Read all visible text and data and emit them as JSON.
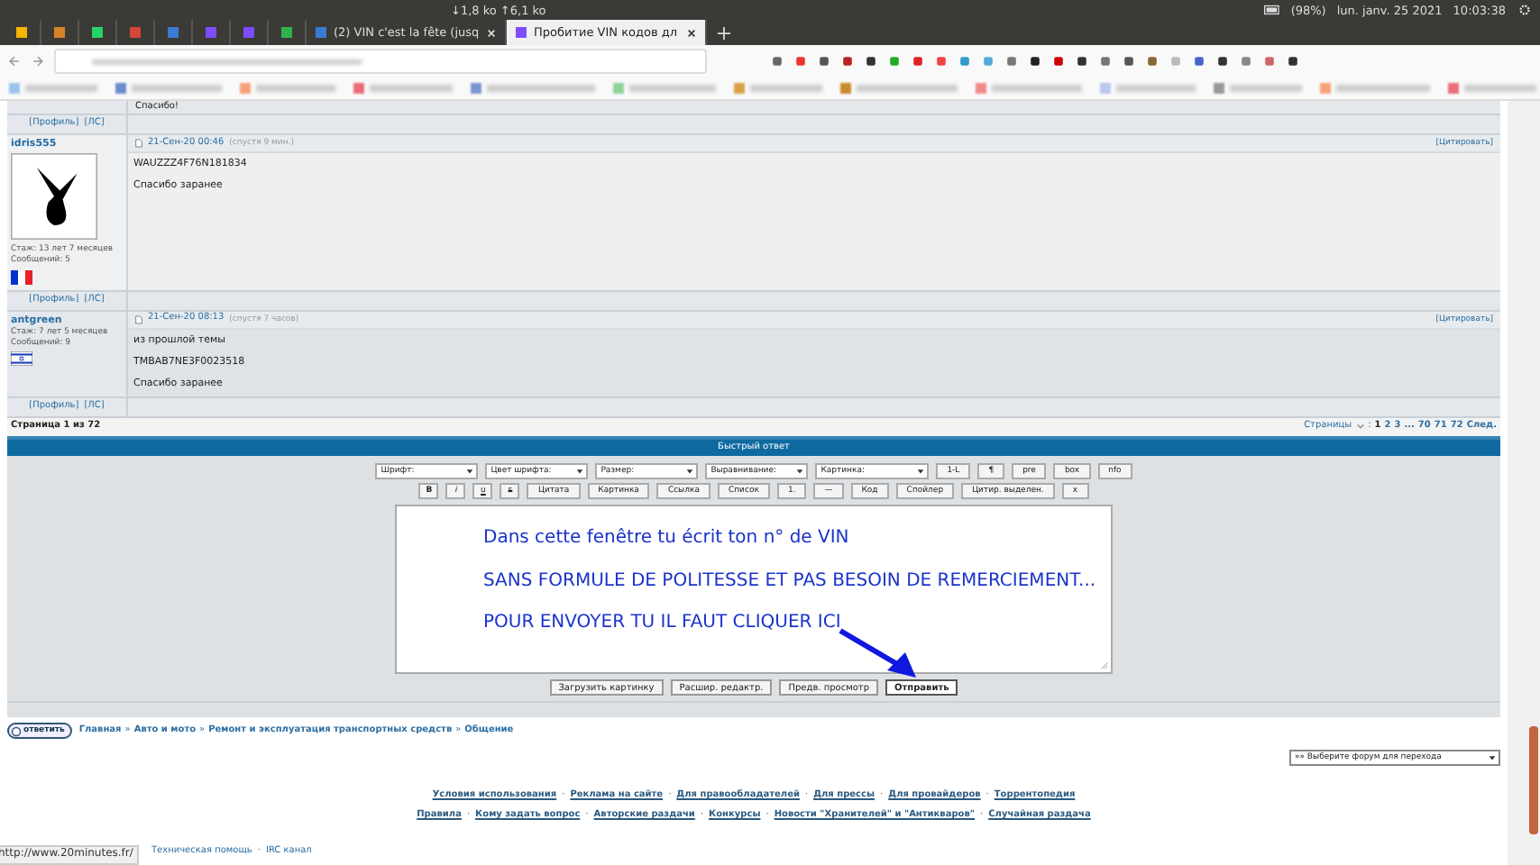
{
  "system_bar": {
    "network": "↓1,8 ko ↑6,1 ko",
    "battery": "(98%)",
    "date": "lun. janv. 25 2021",
    "time": "10:03:38"
  },
  "tabs": [
    {
      "color": "#f5b400",
      "selected": false
    },
    {
      "color": "#d9822b",
      "selected": false
    },
    {
      "color": "#25d366",
      "selected": false
    },
    {
      "color": "#d44638",
      "selected": false
    },
    {
      "color": "#3b7bd4",
      "selected": false
    },
    {
      "color": "#7c4dff",
      "selected": false
    },
    {
      "color": "#7c4dff",
      "selected": false
    },
    {
      "color": "#2eb24b",
      "selected": false
    },
    {
      "title": "(2) VIN c'est la fête (jusq",
      "color": "#3b7bd4",
      "selected": false
    },
    {
      "title": "Пробитие VIN кодов дл",
      "color": "#7c4dff",
      "selected": true
    }
  ],
  "previous_post": {
    "text": "Спасибо!",
    "profile_links": [
      "[Профиль]",
      "[ЛС]"
    ]
  },
  "posts": [
    {
      "author": "idris555",
      "avatar": true,
      "tenure": "Стаж: 13 лет 7 месяцев",
      "messages": "Сообщений: 5",
      "flag": {
        "kind": "tricolor"
      },
      "date": "21-Сен-20 00:46",
      "delay": "(спустя 9 мин.)",
      "quote": "[Цитировать]",
      "lines": [
        "WAUZZZ4F76N181834",
        "Спасибо заранее"
      ],
      "profile_links": [
        "[Профиль]",
        "[ЛС]"
      ]
    },
    {
      "author": "antgreen",
      "avatar": false,
      "tenure": "Стаж: 7 лет 5 месяцев",
      "messages": "Сообщений: 9",
      "flag": {
        "kind": "star"
      },
      "date": "21-Сен-20 08:13",
      "delay": "(спустя 7 часов)",
      "quote": "[Цитировать]",
      "lines": [
        "из прошлой темы",
        "TMBAB7NE3F0023518",
        "Спасибо заранее"
      ],
      "profile_links": [
        "[Профиль]",
        "[ЛС]"
      ]
    }
  ],
  "page_info": "Страница 1 из 72",
  "pagination": {
    "label": "Страницы",
    "colon": ":",
    "pages": [
      {
        "label": "1",
        "selected": true
      },
      {
        "label": "2",
        "selected": false
      },
      {
        "label": "3",
        "selected": false
      },
      {
        "label": "...",
        "selected": false
      },
      {
        "label": "70",
        "selected": false
      },
      {
        "label": "71",
        "selected": false
      },
      {
        "label": "72",
        "selected": false
      }
    ],
    "next": "След."
  },
  "quick_reply": {
    "title": "Быстрый ответ",
    "selects": [
      {
        "label": "Шрифт:",
        "wide": false
      },
      {
        "label": "Цвет шрифта:",
        "wide": false
      },
      {
        "label": "Размер:",
        "wide": false
      },
      {
        "label": "Выравнивание:",
        "wide": false
      },
      {
        "label": "Картинка:",
        "wide": true
      }
    ],
    "row1_buttons": [
      "1-L",
      "¶",
      "pre",
      "box",
      "nfo"
    ],
    "format_buttons": [
      {
        "label": "B",
        "kind": "bold"
      },
      {
        "label": "i",
        "kind": "italic"
      },
      {
        "label": "u",
        "kind": "underline"
      },
      {
        "label": "s",
        "kind": "strike"
      }
    ],
    "row2_buttons": [
      "Цитата",
      "Картинка",
      "Ссылка",
      "Список",
      "1.",
      "—",
      "Код",
      "Спойлер",
      "Цитир. выделен.",
      "x"
    ],
    "message_lines": [
      "Dans cette fenêtre tu écrit ton n° de VIN",
      "SANS FORMULE DE POLITESSE ET PAS BESOIN DE REMERCIEMENT...",
      "POUR ENVOYER TU IL FAUT CLIQUER ICI"
    ],
    "buttons": [
      {
        "label": "Загрузить картинку",
        "primary": false
      },
      {
        "label": "Расшир. редактр.",
        "primary": false
      },
      {
        "label": "Предв. просмотр",
        "primary": false
      },
      {
        "label": "Отправить",
        "primary": true
      }
    ]
  },
  "reply_button": "ответить",
  "breadcrumbs": {
    "separator": "»",
    "items": [
      "Главная",
      "Авто и мото",
      "Ремонт и эксплуатация транспортных средств",
      "Общение"
    ]
  },
  "forum_jump": "»» Выберите форум для перехода",
  "footer": {
    "separator": "·",
    "primary_links": [
      "Условия использования",
      "Реклама на сайте",
      "Для правообладателей",
      "Для прессы",
      "Для провайдеров",
      "Торрентопедия"
    ],
    "secondary_links": [
      "Правила",
      "Кому задать вопрос",
      "Авторские раздачи",
      "Конкурсы",
      "Новости \"Хранителей\" и \"Антикваров\"",
      "Случайная раздача"
    ],
    "bottom_links": [
      "Техническая помощь",
      "IRC канал"
    ]
  },
  "status_url": "http://www.20minutes.fr/"
}
